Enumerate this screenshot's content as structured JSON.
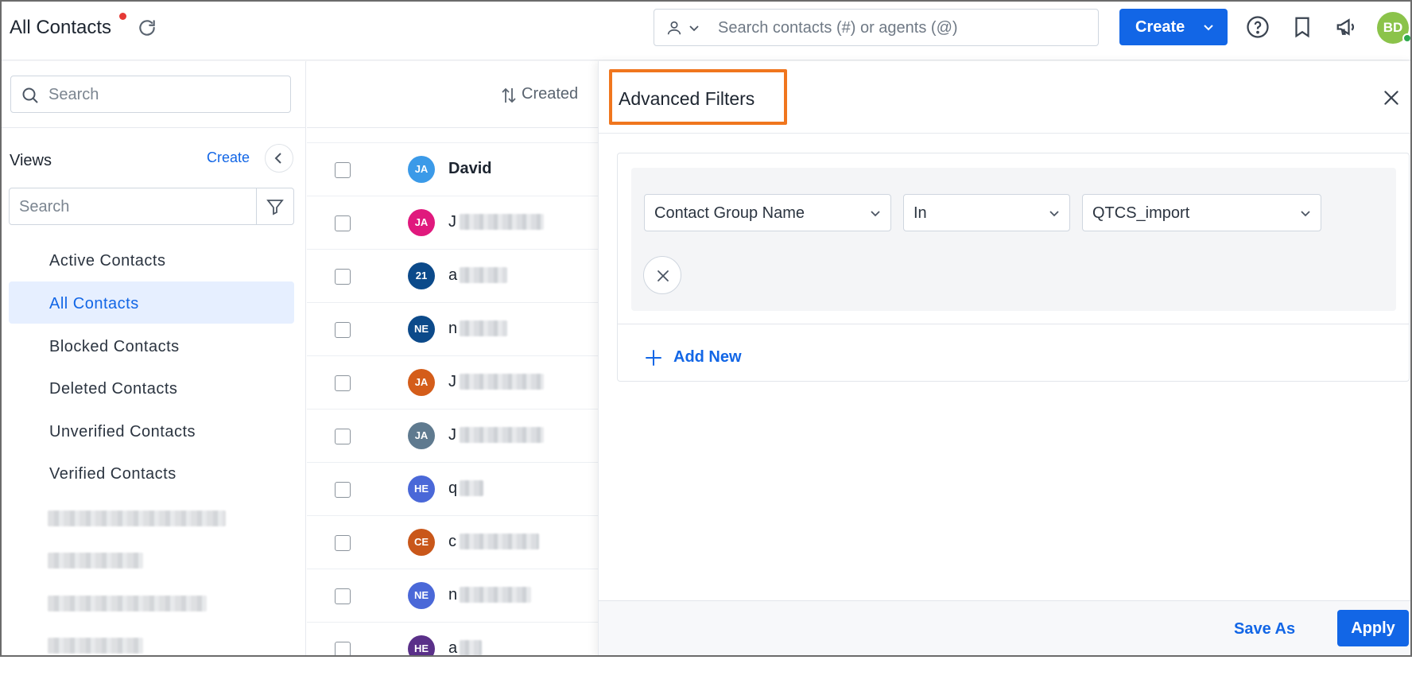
{
  "header": {
    "title": "All Contacts",
    "search_placeholder": "Search contacts (#) or agents (@)",
    "create_label": "Create",
    "user_initials": "BD"
  },
  "left": {
    "search_placeholder": "Search",
    "views_label": "Views",
    "views_create": "Create",
    "views_search_placeholder": "Search",
    "items": [
      {
        "label": "Active Contacts"
      },
      {
        "label": "All Contacts",
        "active": true
      },
      {
        "label": "Blocked Contacts"
      },
      {
        "label": "Deleted Contacts"
      },
      {
        "label": "Unverified Contacts"
      },
      {
        "label": "Verified Contacts"
      }
    ]
  },
  "list": {
    "sort_label": "Created",
    "rows": [
      {
        "initials": "JA",
        "color": "#3b9ae8",
        "name": "David"
      },
      {
        "initials": "JA",
        "color": "#e0197d",
        "name": "J"
      },
      {
        "initials": "21",
        "color": "#0c4a8a",
        "name": "a"
      },
      {
        "initials": "NE",
        "color": "#0c4a8a",
        "name": "n"
      },
      {
        "initials": "JA",
        "color": "#d45d1a",
        "name": "J"
      },
      {
        "initials": "JA",
        "color": "#5f7a8f",
        "name": "J"
      },
      {
        "initials": "HE",
        "color": "#4a68d8",
        "name": "q"
      },
      {
        "initials": "CE",
        "color": "#c9571a",
        "name": "c"
      },
      {
        "initials": "NE",
        "color": "#4a68d8",
        "name": "n"
      },
      {
        "initials": "HE",
        "color": "#5a3089",
        "name": "a"
      }
    ]
  },
  "advanced_filters": {
    "title": "Advanced Filters",
    "field": "Contact Group Name",
    "operator": "In",
    "value": "QTCS_import",
    "add_new_label": "Add New",
    "save_as_label": "Save As",
    "apply_label": "Apply"
  },
  "colors": {
    "primary": "#1266e6",
    "highlight": "#f0761e",
    "active_view_bg": "#e6efff"
  }
}
